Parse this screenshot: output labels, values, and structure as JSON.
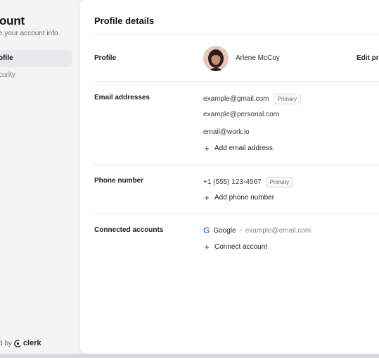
{
  "sidebar": {
    "title": "ount",
    "subtitle": "e your account info.",
    "items": [
      {
        "label": "ofile",
        "active": true
      },
      {
        "label": "curity",
        "active": false
      }
    ],
    "footer_prefix": "d by",
    "brand": "clerk"
  },
  "main": {
    "title": "Profile details",
    "profile": {
      "label": "Profile",
      "name": "Arlene McCoy",
      "edit_label": "Edit pro"
    },
    "emails": {
      "label": "Email addresses",
      "items": [
        {
          "address": "example@gmail.com",
          "badge": "Primary"
        },
        {
          "address": "example@personal.com",
          "badge": ""
        },
        {
          "address": "email@work.io",
          "badge": ""
        }
      ],
      "add_label": "Add email address"
    },
    "phone": {
      "label": "Phone number",
      "number": "+1 (555) 123-4567",
      "badge": "Primary",
      "add_label": "Add phone number"
    },
    "connected": {
      "label": "Connected accounts",
      "provider": "Google",
      "provider_icon": "G",
      "email": "example@email.com",
      "add_label": "Connect account"
    }
  },
  "colors": {
    "google_blue": "#4285F4",
    "sidebar_bg": "#f4f4f5",
    "panel_bg": "#ffffff"
  }
}
